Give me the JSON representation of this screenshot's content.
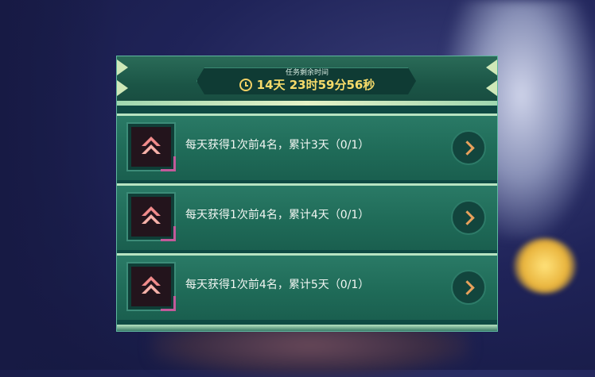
{
  "timer": {
    "label": "任务剩余时间",
    "value": "14天 23时59分56秒",
    "icon": "clock-icon"
  },
  "tasks": [
    {
      "text": "每天获得1次前4名，累计3天（0/1）",
      "icon": "rank-up-icon",
      "button_icon": "chevron-right-icon"
    },
    {
      "text": "每天获得1次前4名，累计4天（0/1）",
      "icon": "rank-up-icon",
      "button_icon": "chevron-right-icon"
    },
    {
      "text": "每天获得1次前4名，累计5天（0/1）",
      "icon": "rank-up-icon",
      "button_icon": "chevron-right-icon"
    }
  ],
  "colors": {
    "panel": "#0f4a44",
    "timer_text": "#f6db6a",
    "icon_accent": "#f08a8a",
    "button_chevron": "#e8a15c"
  }
}
